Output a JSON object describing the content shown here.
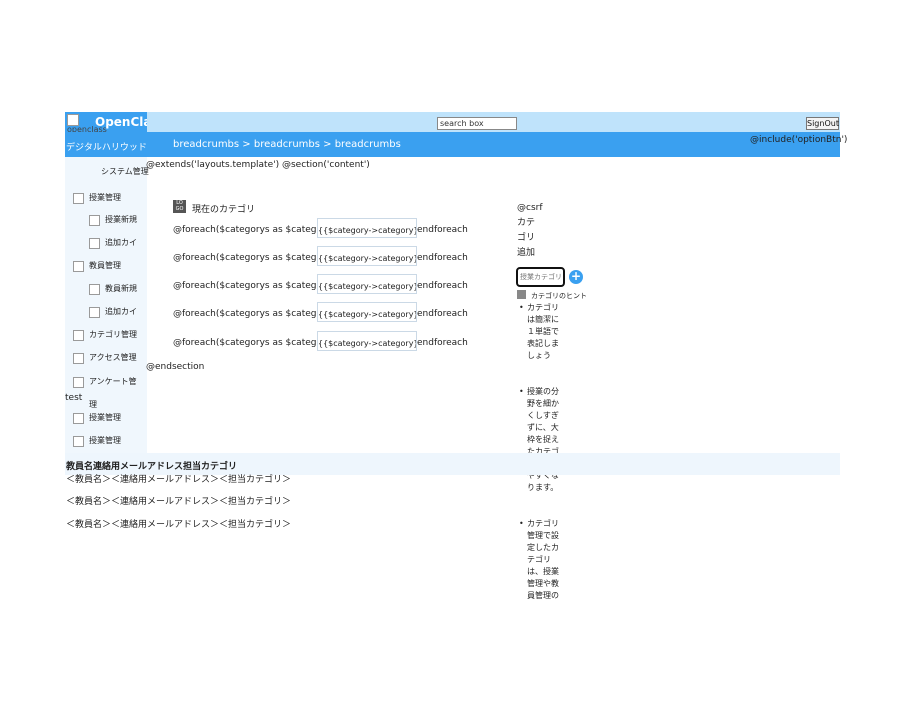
{
  "header": {
    "logo_alt": "openclass",
    "logo_text": "OpenClass",
    "search_value": "search box",
    "signout_label": "SignOut"
  },
  "subheader": {
    "university": "デジタルハリウッド大学",
    "breadcrumb": "breadcrumbs > breadcrumbs > breadcrumbs",
    "include_btn": "@include('optionBtn')"
  },
  "sidebar": {
    "title": "システム管理",
    "items": [
      {
        "label": "授業管理"
      },
      {
        "label": "授業新規"
      },
      {
        "label": "追加カイ"
      },
      {
        "label": "教員管理"
      },
      {
        "label": "教員新規"
      },
      {
        "label": "追加カイ"
      },
      {
        "label": "カテゴリ管理"
      },
      {
        "label": "アクセス管理"
      },
      {
        "label": "アンケート管"
      },
      {
        "label": "理"
      },
      {
        "label": "授業管理"
      },
      {
        "label": "授業管理"
      }
    ],
    "test_label": "test"
  },
  "main": {
    "extends": "@extends('layouts.template') @section('content')",
    "current_category": "現在のカテゴリ",
    "loop_prefix": "@foreach($categorys as $catego",
    "loop_input": "{{$category->category}}",
    "loop_suffix": "endforeach",
    "endsection": "@endsection"
  },
  "right": {
    "csrf": "@csrf",
    "add_label": "カテゴリ追加",
    "add_placeholder": "授業カテゴリ",
    "hint_title": "カテゴリのヒント",
    "hints": [
      "カテゴリは簡潔に１単語で表記しましょう",
      "授業の分野を細かくしすぎずに、大枠を捉えたカテゴがわかりやすくなります。",
      "カテゴリ管理で設定したカテゴリは、授業管理や教員管理の"
    ]
  },
  "table": {
    "header": "教員名連絡用メールアドレス担当カテゴリ",
    "rows": [
      "＜教員名＞＜連絡用メールアドレス＞＜担当カテゴリ＞",
      "＜教員名＞＜連絡用メールアドレス＞＜担当カテゴリ＞",
      "＜教員名＞＜連絡用メールアドレス＞＜担当カテゴリ＞"
    ]
  },
  "colors": {
    "primary": "#3aa0f0",
    "topbar": "#bfe3fb",
    "sidebar": "#f0f7fd"
  }
}
